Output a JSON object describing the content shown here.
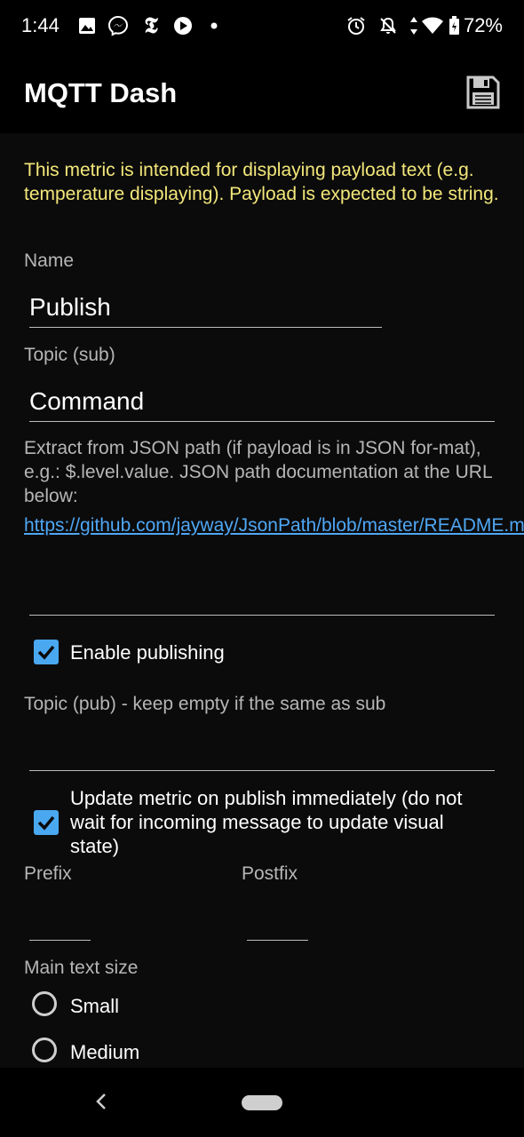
{
  "status_bar": {
    "time": "1:44",
    "battery": "72%",
    "icons": [
      "gallery-icon",
      "messenger-icon",
      "nytimes-icon",
      "play-icon",
      "dot-icon",
      "alarm-icon",
      "notifications-off-icon",
      "data-arrows-icon",
      "wifi-icon",
      "battery-icon"
    ]
  },
  "app_bar": {
    "title": "MQTT Dash",
    "save_icon": "save-icon"
  },
  "form": {
    "info": "This metric is intended for displaying payload text (e.g. temperature displaying). Payload is expected to be string.",
    "name": {
      "label": "Name",
      "value": "Publish"
    },
    "topic_sub": {
      "label": "Topic (sub)",
      "value": "Command"
    },
    "json_path": {
      "help": "Extract from JSON path (if payload is in JSON for-mat), e.g.: $.level.value. JSON path documentation at the URL below:",
      "link": "https://github.com/jayway/JsonPath/blob/master/README.md",
      "value": ""
    },
    "enable_publishing": {
      "label": "Enable publishing",
      "checked": true
    },
    "topic_pub": {
      "label": "Topic (pub) - keep empty if the same as sub",
      "value": ""
    },
    "update_on_publish": {
      "label": "Update metric on publish immediately (do not wait for incoming message to update visual state)",
      "checked": true
    },
    "prefix": {
      "label": "Prefix",
      "value": ""
    },
    "postfix": {
      "label": "Postfix",
      "value": ""
    },
    "main_text_size": {
      "label": "Main text size",
      "options": [
        "Small",
        "Medium"
      ],
      "selected": null
    }
  },
  "colors": {
    "accent": "#4aa8f0",
    "info_text": "#f3e77a",
    "link": "#4fa7f4",
    "background": "#0b0b0b"
  }
}
